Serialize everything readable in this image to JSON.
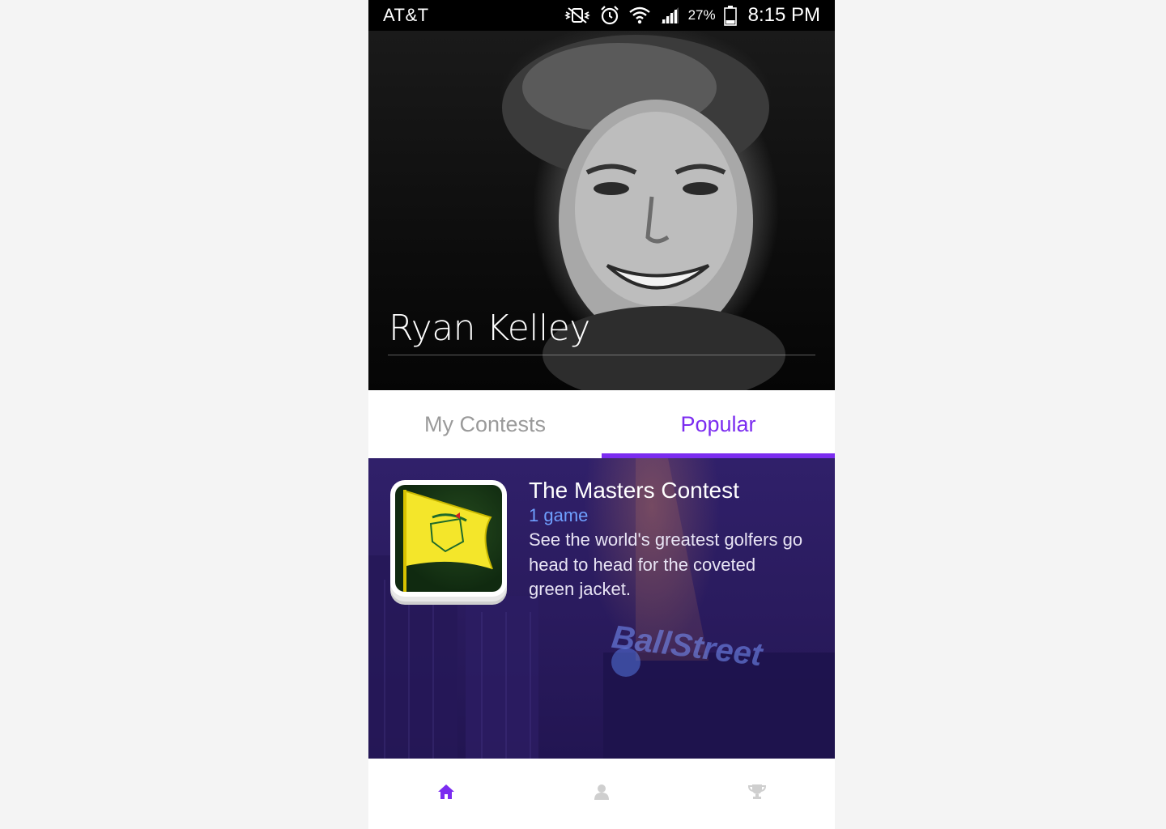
{
  "status_bar": {
    "carrier": "AT&T",
    "battery_percent": "27%",
    "time": "8:15 PM",
    "icons": [
      "vibrate-icon",
      "alarm-icon",
      "wifi-icon",
      "signal-icon",
      "battery-icon"
    ]
  },
  "profile": {
    "name": "Ryan Kelley"
  },
  "tabs": [
    {
      "label": "My Contests",
      "active": false
    },
    {
      "label": "Popular",
      "active": true
    }
  ],
  "contest": {
    "title": "The Masters Contest",
    "meta": "1 game",
    "description": "See the world's greatest golfers go head to head for the coveted green jacket.",
    "background_text": "BallStreet"
  },
  "bottom_nav": [
    {
      "icon": "home-icon",
      "active": true
    },
    {
      "icon": "user-icon",
      "active": false
    },
    {
      "icon": "trophy-icon",
      "active": false
    }
  ],
  "colors": {
    "accent": "#7b2cf0",
    "meta_blue": "#6fa0ff",
    "card_bg": "#2a1b5e",
    "inactive": "#9a9a9a"
  }
}
